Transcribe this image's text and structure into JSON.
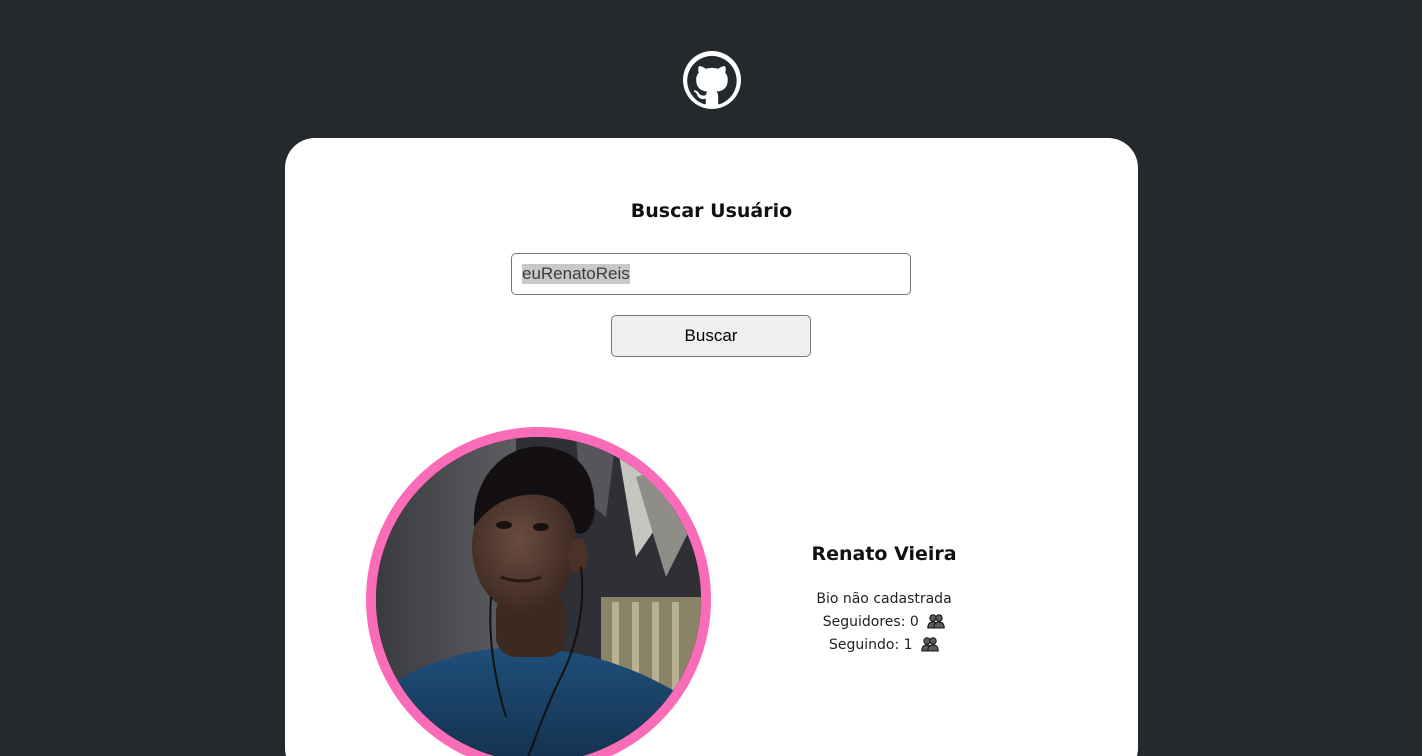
{
  "header": {
    "logo_icon": "github-octocat-icon"
  },
  "search": {
    "title": "Buscar Usuário",
    "input_value": "euRenatoReis",
    "button_label": "Buscar"
  },
  "profile": {
    "name": "Renato Vieira",
    "bio": "Bio não cadastrada",
    "followers_label": "Seguidores: 0",
    "following_label": "Seguindo: 1",
    "avatar_icon": "user-avatar-photo",
    "stat_icon": "people-icon"
  },
  "colors": {
    "background": "#24292e",
    "card": "#ffffff",
    "avatar_border": "#fb6cb8"
  }
}
